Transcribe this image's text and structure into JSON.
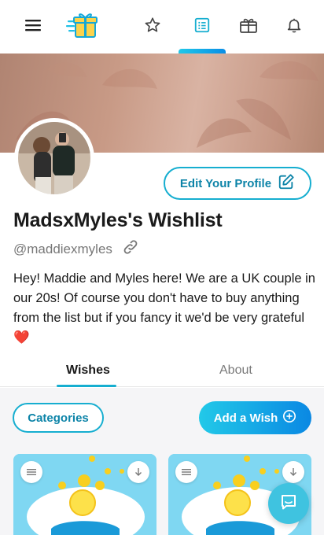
{
  "nav": {
    "icons": [
      "menu-icon",
      "gift-logo-icon",
      "star-icon",
      "list-icon",
      "gift-box-icon",
      "bell-icon"
    ],
    "active": "list-icon",
    "accent": "#16aed0"
  },
  "profile": {
    "edit_label": "Edit Your Profile",
    "title": "MadsxMyles's Wishlist",
    "handle": "@maddiexmyles",
    "bio": "Hey! Maddie and Myles here! We are a UK couple in our 20s! Of course you don't have to buy anything from the list but if you fancy it we'd be very grateful",
    "bio_emoji": "❤️"
  },
  "tabs": [
    {
      "label": "Wishes",
      "active": true
    },
    {
      "label": "About",
      "active": false
    }
  ],
  "actions": {
    "categories_label": "Categories",
    "add_wish_label": "Add a Wish"
  },
  "colors": {
    "primary": "#16aed0",
    "primary_dark": "#0a88e3",
    "text_dark": "#1a1a1a",
    "muted": "#777777",
    "heart": "#d9202a"
  }
}
